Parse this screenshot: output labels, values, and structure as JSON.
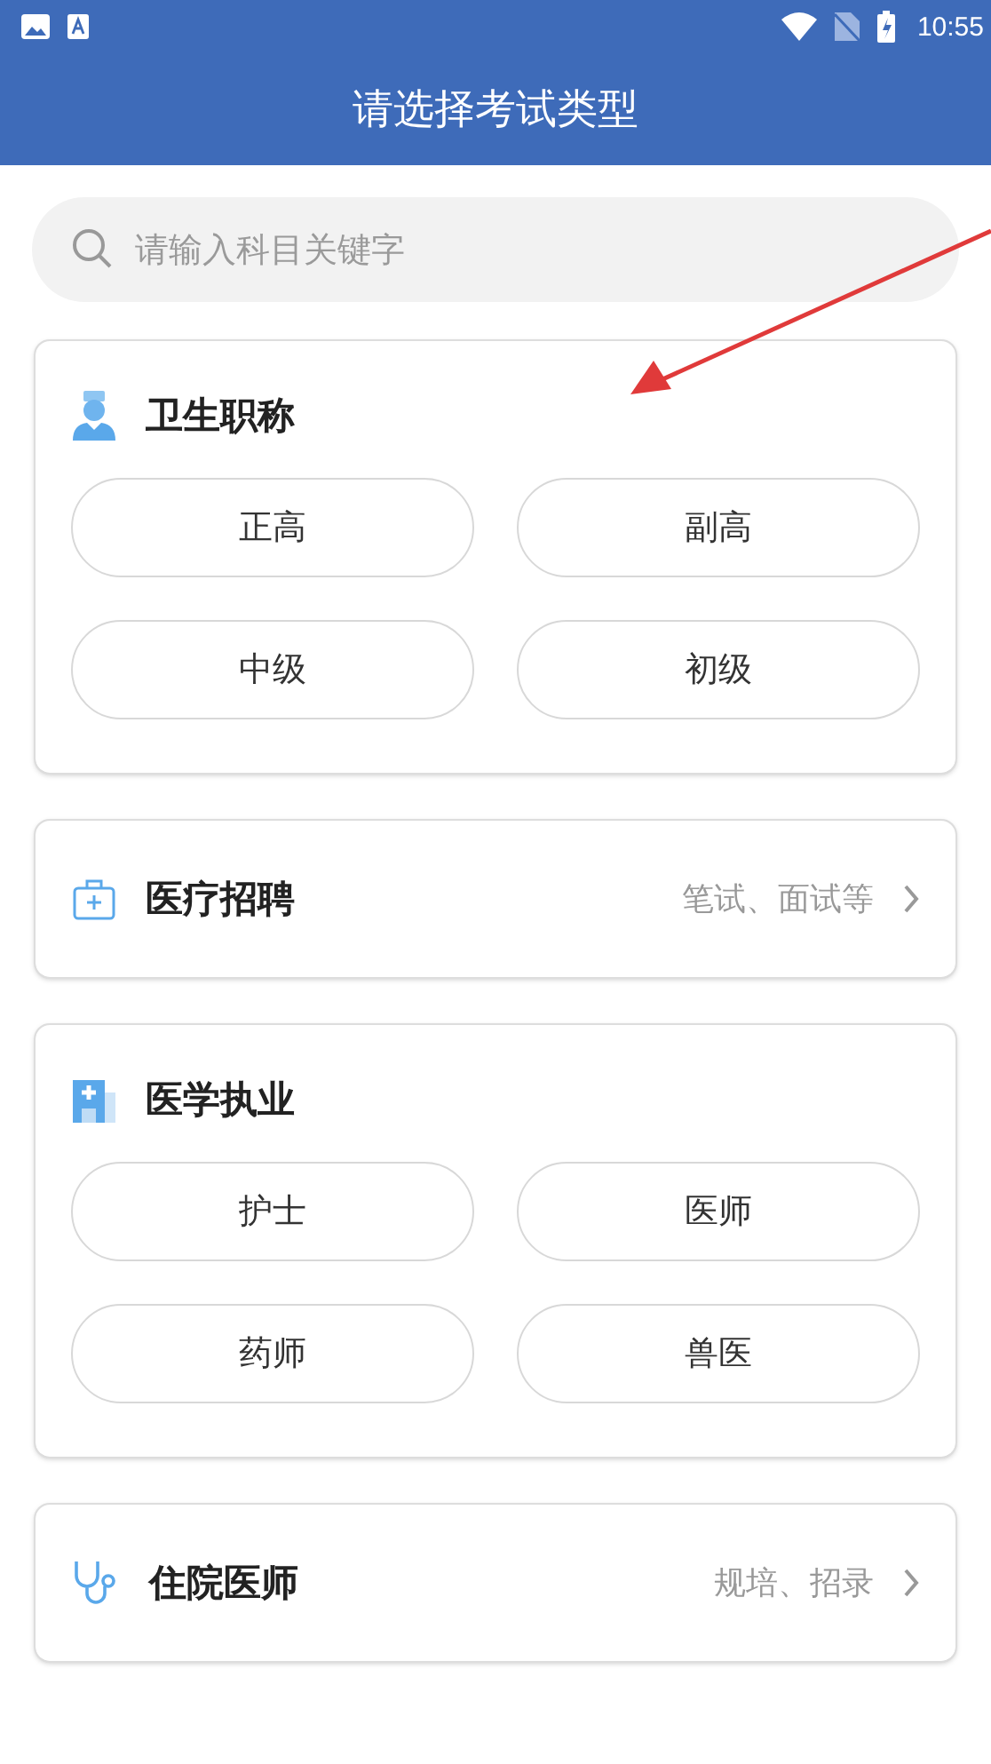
{
  "status_bar": {
    "time": "10:55"
  },
  "header": {
    "title": "请选择考试类型"
  },
  "search": {
    "placeholder": "请输入科目关键字"
  },
  "sections": [
    {
      "kind": "grid",
      "title": "卫生职称",
      "options": [
        "正高",
        "副高",
        "中级",
        "初级"
      ]
    },
    {
      "kind": "link",
      "title": "医疗招聘",
      "hint": "笔试、面试等"
    },
    {
      "kind": "grid",
      "title": "医学执业",
      "options": [
        "护士",
        "医师",
        "药师",
        "兽医"
      ]
    },
    {
      "kind": "link",
      "title": "住院医师",
      "hint": "规培、招录"
    }
  ]
}
